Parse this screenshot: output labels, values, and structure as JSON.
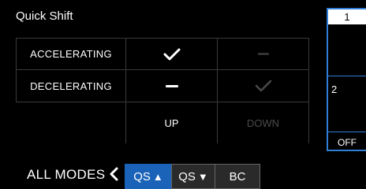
{
  "screen": {
    "title": "Quick Shift"
  },
  "table": {
    "rows": [
      {
        "label": "ACCELERATING",
        "up": "check",
        "down": "dash"
      },
      {
        "label": "DECELERATING",
        "up": "dash",
        "down": "check"
      }
    ],
    "columns": {
      "up": "UP",
      "down": "DOWN"
    }
  },
  "gear_indicator": {
    "top": "1",
    "middle": "2",
    "bottom": "OFF"
  },
  "bottom_bar": {
    "mode_label": "ALL MODES",
    "tabs": [
      {
        "label": "QS",
        "arrow": "▲",
        "active": true
      },
      {
        "label": "QS",
        "arrow": "▼",
        "active": false
      },
      {
        "label": "BC",
        "active": false
      }
    ]
  },
  "colors": {
    "accent": "#1a63b8",
    "border": "#2f7fd6",
    "dim": "#4a4a4a"
  }
}
